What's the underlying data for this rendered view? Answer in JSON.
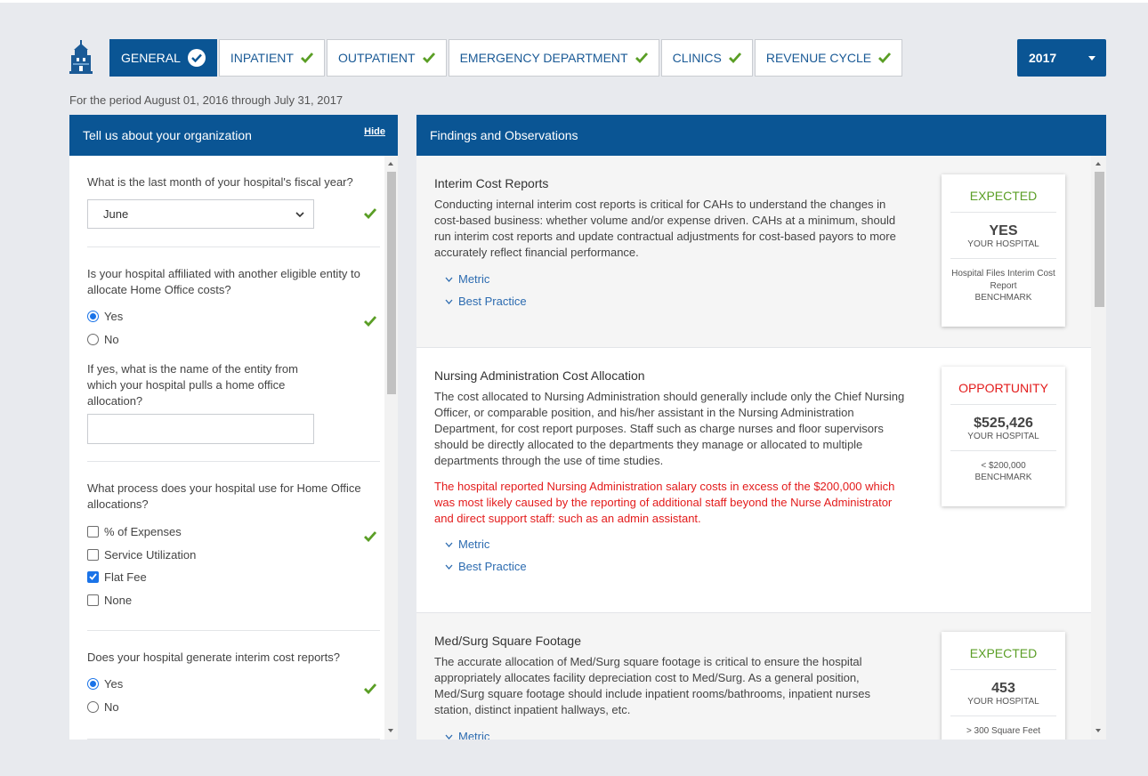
{
  "tabs": [
    {
      "label": "GENERAL",
      "active": true
    },
    {
      "label": "INPATIENT",
      "active": false
    },
    {
      "label": "OUTPATIENT",
      "active": false
    },
    {
      "label": "EMERGENCY DEPARTMENT",
      "active": false
    },
    {
      "label": "CLINICS",
      "active": false
    },
    {
      "label": "REVENUE CYCLE",
      "active": false
    }
  ],
  "year": {
    "selected": "2017"
  },
  "period_text": "For the period August 01, 2016 through July 31, 2017",
  "left_panel": {
    "title": "Tell us about your organization",
    "hide_label": "Hide",
    "q1": {
      "text": "What is the last month of your hospital's fiscal year?",
      "value": "June"
    },
    "q2": {
      "text": "Is your hospital affiliated with another eligible entity to allocate Home Office costs?",
      "opt_yes": "Yes",
      "opt_no": "No"
    },
    "q3": {
      "text": "If yes, what is the name of the entity from which your hospital pulls a home office allocation?",
      "value": ""
    },
    "q4": {
      "text": "What process does your hospital use for Home Office allocations?",
      "opts": [
        "% of Expenses",
        "Service Utilization",
        "Flat Fee",
        "None"
      ],
      "checked": [
        "Flat Fee"
      ]
    },
    "q5": {
      "text": "Does your hospital generate interim cost reports?",
      "opt_yes": "Yes",
      "opt_no": "No"
    }
  },
  "right_panel": {
    "title": "Findings and Observations",
    "findings": [
      {
        "title": "Interim Cost Reports",
        "desc": "Conducting internal interim cost reports is critical for CAHs to understand the changes in cost-based business: whether volume and/or expense driven. CAHs at a minimum, should run interim cost reports and update contractual adjustments for cost-based payors to more accurately reflect financial performance.",
        "metric_label": "Metric",
        "best_practice_label": "Best Practice",
        "status": "EXPECTED",
        "value": "YES",
        "value_label": "YOUR HOSPITAL",
        "benchmark": "Hospital Files Interim Cost Report",
        "benchmark_label": "BENCHMARK"
      },
      {
        "title": "Nursing Administration Cost Allocation",
        "desc": "The cost allocated to Nursing Administration should generally include only the Chief Nursing Officer, or comparable position, and his/her assistant in the Nursing Administration Department, for cost report purposes. Staff such as charge nurses and floor supervisors should be directly allocated to the departments they manage or allocated to multiple departments through the use of time studies.",
        "warning": "The hospital reported Nursing Administration salary costs in excess of the $200,000 which was most likely caused by the reporting of additional staff beyond the Nurse Administrator and direct support staff: such as an admin assistant.",
        "metric_label": "Metric",
        "best_practice_label": "Best Practice",
        "status": "OPPORTUNITY",
        "value": "$525,426",
        "value_label": "YOUR HOSPITAL",
        "benchmark": "< $200,000",
        "benchmark_label": "BENCHMARK"
      },
      {
        "title": "Med/Surg Square Footage",
        "desc": "The accurate allocation of Med/Surg square footage is critical to ensure the hospital appropriately allocates facility depreciation cost to Med/Surg. As a general position, Med/Surg square footage should include inpatient rooms/bathrooms, inpatient nurses station, distinct inpatient hallways, etc.",
        "metric_label": "Metric",
        "status": "EXPECTED",
        "value": "453",
        "value_label": "YOUR HOSPITAL",
        "benchmark": "> 300 Square Feet"
      }
    ]
  },
  "colors": {
    "primary": "#0a5594",
    "check_green": "#5a9e25",
    "warning_red": "#e31b1b",
    "link": "#2c6bb0"
  }
}
